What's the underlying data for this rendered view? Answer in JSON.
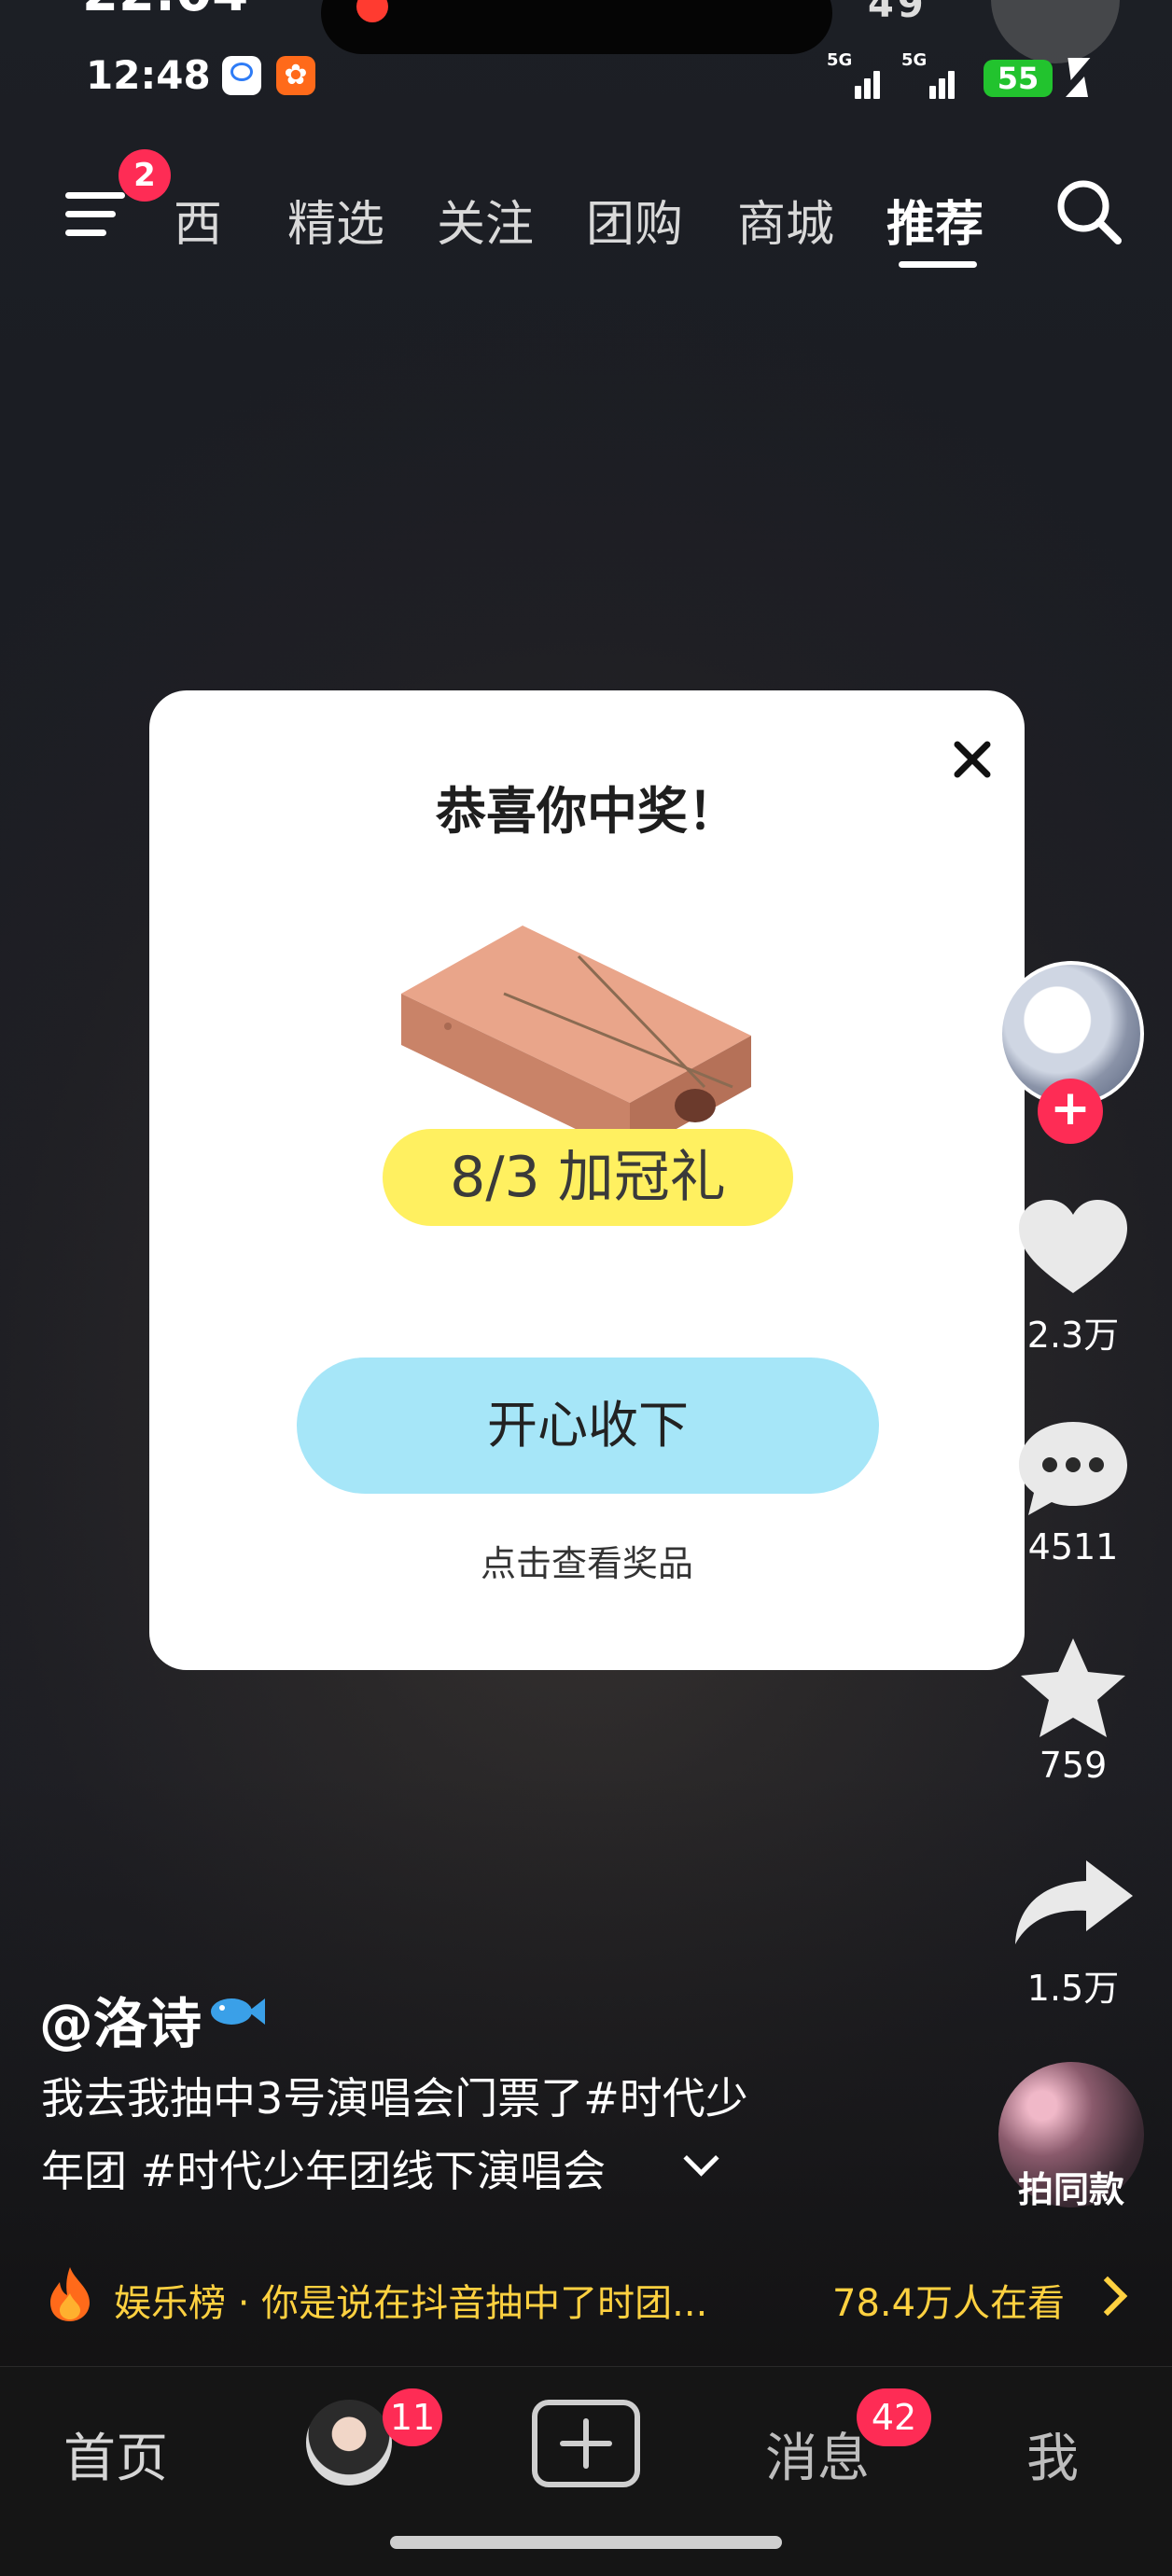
{
  "status_bar": {
    "ghost_time": "22:04",
    "time": "12:48",
    "signal1_label": "5G",
    "signal2_label": "5G",
    "battery": "55",
    "ghost_right": "49"
  },
  "top_nav": {
    "menu_badge": "2",
    "tabs": [
      "西",
      "精选",
      "关注",
      "团购",
      "商城",
      "推荐"
    ],
    "active_tab": "推荐"
  },
  "modal": {
    "title": "恭喜你中奖！",
    "prize_label": "8/3 加冠礼",
    "accept_button": "开心收下",
    "view_prize_link": "点击查看奖品"
  },
  "right_rail": {
    "like_count": "2.3万",
    "comment_count": "4511",
    "favorite_count": "759",
    "share_count": "1.5万",
    "same_style_label": "拍同款"
  },
  "caption": {
    "author": "@洛诗",
    "description_line1": "我去我抽中3号演唱会门票了#时代少",
    "description_line2": "年团 #时代少年团线下演唱会"
  },
  "entertainment_bar": {
    "text": "娱乐榜 · 你是说在抖音抽中了时团...",
    "viewers": "78.4万人在看"
  },
  "bottom_tabs": {
    "home": "首页",
    "friends_badge": "11",
    "messages": "消息",
    "messages_badge": "42",
    "me": "我"
  },
  "colors": {
    "accent_red": "#fe2c55",
    "gold": "#ffd140",
    "accept_button": "#a6e6f8",
    "prize_highlight": "#fff060"
  }
}
